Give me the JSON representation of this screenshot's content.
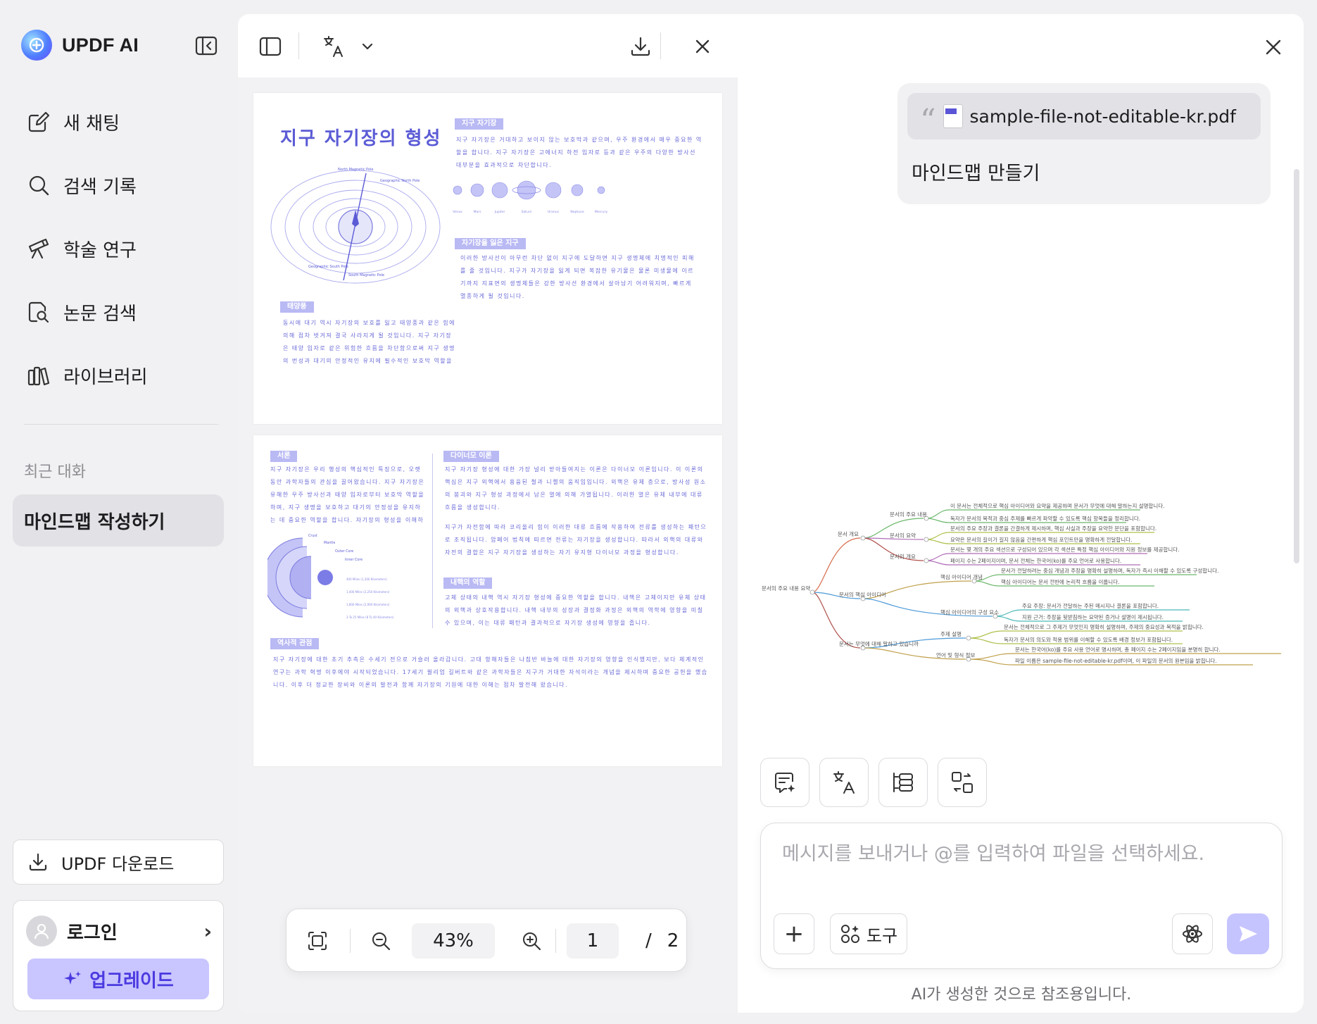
{
  "sidebar": {
    "brand": "UPDF AI",
    "nav": [
      {
        "label": "새 채팅",
        "icon": "new-chat-icon"
      },
      {
        "label": "검색 기록",
        "icon": "search-icon"
      },
      {
        "label": "학술 연구",
        "icon": "telescope-icon"
      },
      {
        "label": "논문 검색",
        "icon": "paper-search-icon"
      },
      {
        "label": "라이브러리",
        "icon": "library-icon"
      }
    ],
    "recent_title": "최근 대화",
    "recent_items": [
      "마인드맵 작성하기"
    ],
    "download_label": "UPDF 다운로드",
    "login_label": "로그인",
    "upgrade_label": "업그레이드"
  },
  "viewer": {
    "zoom": "43%",
    "current_page": "1",
    "total_pages": "2",
    "page_separator": "/",
    "page1": {
      "title": "지구 자기장의 형성",
      "tag1": "지구 자기장",
      "tag2": "자기장을 잃은 지구",
      "tag3": "태양풍",
      "text1": "지구 자기장은 거대하고 보이지 않는 보호막과 같으며, 우주 환경에서 매우 중요한 역할을 합니다. 지구 자기장은 고에너지 하전 입자로 등과 같은 우주의 다양한 방사선 대부분을 효과적으로 차단합니다.",
      "text2": "이러한 방사선이 아무런 차단 없이 지구에 도달하면 지구 생명체에 치명적인 피해를 줄 것입니다. 지구가 자기장을 잃게 되면 복잡한 유기물은 물론 미생물에 이르기까지 지표면의 생명체들은 강한 방사선 환경에서 살아남기 어려워지며, 빠르게 멸종하게 될 것입니다.",
      "text3": "동시에 대기 역시 자기장의 보호를 잃고 태양풍과 같은 힘에 의해 점차 벗겨져 결국 사라지게 될 것입니다. 지구 자기장은 태양 입자로 같은 위험한 흐름을 차단함으로써 지구 생명의 번성과 대기의 안정적인 유지에 필수적인 보호막 역할을 한다고 할 수 있습니다.",
      "diagram_labels": {
        "north_magnetic": "North Magnetic Pole",
        "geographic_north": "Geographic North Pole",
        "geographic_south": "Geographic South Pole",
        "south_magnetic": "South Magnetic Pole"
      },
      "planets": [
        "Venus",
        "Mars",
        "Jupiter",
        "Saturn",
        "Uranus",
        "Neptune",
        "Mercury"
      ]
    },
    "page2": {
      "tag1": "서론",
      "tag2": "다이너모 이론",
      "tag3": "내핵의 역할",
      "tag4": "역사적 관점",
      "text1": "지구 자기장은 우리 행성의 핵심적인 특징으로, 오랫동안 과학자들의 관심을 끌어왔습니다. 지구 자기장은 유해한 우주 방사선과 태양 입자로부터 보호막 역할을 하며, 지구 생명을 보호하고 대기의 안정성을 유지하는 데 중요한 역할을 합니다. 자기장의 형성을 이해하는 것은 지구물리학에서 우주생물학에 이르기까지 다양한 과학 분야의 기초가 됩니다.",
      "text2": "지구 자기장 형성에 대한 가장 널리 받아들여지는 이론은 다이너모 이론입니다. 이 이론의 핵심은 지구 외핵에서 용융된 철과 니켈의 움직임입니다. 외핵은 유체 층으로, 방사성 원소의 붕괴와 지구 형성 과정에서 남은 열에 의해 가열됩니다. 이러한 열은 유체 내부에 대류 흐름을 생성합니다.",
      "text3": "지구가 자전함에 따라 코리올리 힘이 이러한 대류 흐름에 작용하여 전류를 생성하는 패턴으로 조직됩니다. 암페어 법칙에 따르면 전류는 자기장을 생성합니다. 따라서 외핵의 대류와 자전의 결합은 지구 자기장을 생성하는 자기 유지형 다이너모 과정을 형성합니다.",
      "text4": "고체 상태의 내핵 역시 자기장 형성에 중요한 역할을 합니다. 내핵은 고체이지만 유체 상태의 외핵과 상호작용합니다. 내핵 내부의 성장과 결정화 과정은 외핵의 역학에 영향을 미칠 수 있으며, 이는 대류 패턴과 결과적으로 자기장 생성에 영향을 줍니다.",
      "text5": "지구 자기장에 대한 초기 추측은 수세기 전으로 거슬러 올라갑니다. 고대 항해자들은 나침반 바늘에 대한 자기장의 영향을 인식했지만, 보다 체계적인 연구는 과학 혁명 이후에야 시작되었습니다. 17세기 윌리엄 길버트와 같은 과학자들은 지구가 거대한 자석이라는 개념을 제시하며 중요한 공헌을 했습니다. 이후 더 정교한 장비와 이론의 발전과 함께 자기장의 기원에 대한 이해는 점차 발전해 왔습니다.",
      "layers": [
        "Crust",
        "Mantle",
        "Outer Core",
        "Inner Core"
      ],
      "layer_depths": [
        "400 Miles (1,300 Kilometers)",
        "1,400 Miles (2,250 Kilometers)",
        "1,800 Miles (2,900 Kilometers)",
        "3 To 25 Miles (8 To 40 Kilometers)"
      ]
    }
  },
  "chat": {
    "file_name": "sample-file-not-editable-kr.pdf",
    "user_message": "마인드맵 만들기",
    "mindmap": {
      "root": "문서의 주요 내용 요약",
      "branches": [
        {
          "label": "문서 개요",
          "children": [
            {
              "label": "문서의 주요 내용",
              "leaves": [
                "이 문서는 전체적으로 핵심 아이디어와 요약을 제공하며 문서가 무엇에 대해 말하는지 설명합니다.",
                "독자가 문서의 목적과 중심 주제를 빠르게 파악할 수 있도록 핵심 항목들을 정리합니다."
              ]
            },
            {
              "label": "문서의 요약",
              "leaves": [
                "문서의 주요 주장과 결론을 간결하게 제시하며, 핵심 사실과 주장을 요약한 문단을 포함합니다.",
                "요약은 문서의 길이가 길지 않음을 간편하게 핵심 포인트만을 명확하게 전달합니다."
              ]
            },
            {
              "label": "문서의 개요",
              "leaves": [
                "문서는 몇 개의 주요 섹션으로 구성되어 있으며 각 섹션은 특정 핵심 아이디어와 지원 정보를 제공합니다.",
                "페이지 수는 2페이지이며, 문서 전체는 한국어(ko)를 주요 언어로 사용합니다."
              ]
            }
          ]
        },
        {
          "label": "문서의 핵심 아이디어",
          "children": [
            {
              "label": "핵심 아이디어 개념",
              "leaves": [
                "문서가 전달하려는 중심 개념과 주장을 명확히 설명하며, 독자가 즉시 이해할 수 있도록 구성합니다.",
                "핵심 아이디어는 문서 전반에 논리적 흐름을 이룹니다."
              ]
            },
            {
              "label": "핵심 아이디어의 구성 요소",
              "leaves": [
                "주요 주장: 문서가 전달하는 주된 메시지나 결론을 포함합니다.",
                "지원 근거: 주장을 뒷받침하는 요약된 증거나 설명이 제시됩니다."
              ]
            }
          ]
        },
        {
          "label": "문서는 무엇에 대해 말하고 있습니까",
          "children": [
            {
              "label": "주제 설명",
              "leaves": [
                "문서는 전체적으로 그 주제가 무엇인지 명확히 설명하며, 주제의 중요성과 목적을 밝힙니다.",
                "독자가 문서의 의도와 적용 범위를 이해할 수 있도록 배경 정보가 포함됩니다."
              ]
            },
            {
              "label": "언어 및 형식 정보",
              "leaves": [
                "문서는 한국어(ko)를 주요 사용 언어로 명시하며, 총 페이지 수는 2페이지임을 분명히 합니다.",
                "파일 이름은 sample-file-not-editable-kr.pdf이며, 이 파일의 문서의 원본임을 밝힙니다."
              ]
            }
          ]
        }
      ]
    },
    "input_placeholder": "메시지를 보내거나 @를 입력하여 파일을 선택하세요.",
    "tools_label": "도구",
    "disclaimer": "AI가 생성한 것으로 참조용입니다."
  },
  "colors": {
    "accent": "#5b5bd6",
    "send_button": "#c6c4ff",
    "upgrade_bg": "#c9c5ff"
  }
}
